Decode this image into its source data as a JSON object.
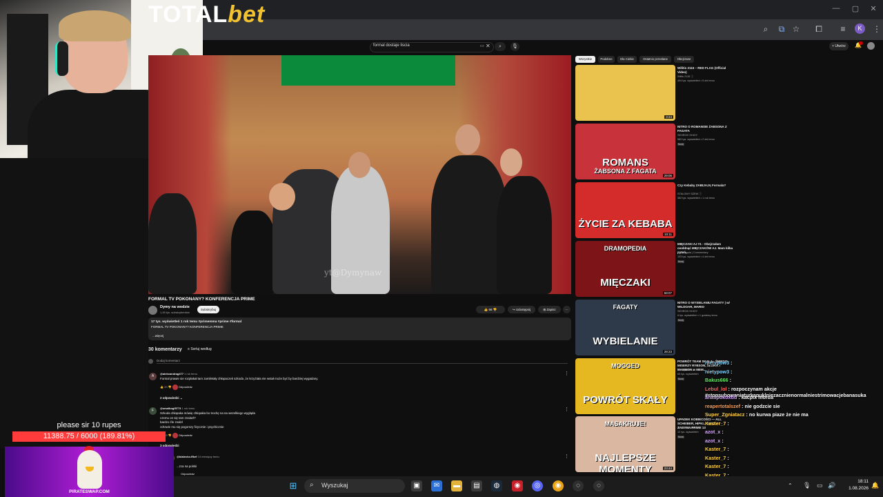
{
  "browser": {
    "window_controls": [
      "—",
      "▢",
      "✕"
    ],
    "profile_letter": "K"
  },
  "youtube": {
    "search_value": "formal dostaje liscia",
    "create_label": "+ Utwórz",
    "video": {
      "banner_brand": "TOTAL",
      "banner_brand_accent": "bet",
      "watermark": "yt@Dymynaw",
      "title": "FORMAL TV POKONANY? KONFERENCJA PRIME",
      "channel_name": "Dymy na wodzie",
      "channel_subs": "1,45 tys. subskrybentów",
      "subscribe_label": "Subskrybuj",
      "likes": "66",
      "share_label": "Udostępnij",
      "save_label": "Zapisz",
      "desc_meta": "17 tys. wyświetleń  1 rok temu  #primemma #prime #formal",
      "desc_line": "FORMAL TV  POKONANY? KONFERENCJA PRIME",
      "desc_more": "...więcej"
    },
    "comments": {
      "count_label": "30 komentarzy",
      "sort_label": "Sortuj według",
      "add_placeholder": "Dodaj komentarz",
      "items": [
        {
          "avatar": "A",
          "author": "@alekxandrag477",
          "time": "1 rok temu",
          "text": "Formal prawie sie rozpłakał tam zamiletały chłopaczek szkoda ,że krzyżtała nie wstał może być by bardziej wygadany.",
          "likes": "20",
          "reply": "Odpowiedz",
          "replies": "2 odpowiedzi"
        },
        {
          "avatar": "F",
          "author": "@smalbogl5773",
          "time": "1 rok temu",
          "text": "Szkoda chłopaka mówię chłopaka bo trochę na na  wszelkiego wygląda\nczemu on się tam znalazł?\nbardzo źle znalzł\nzdrowie mu się pogorszy fizycznie i psychicznie",
          "likes": "19",
          "reply": "Odpowiedz",
          "replies": "3 odpowiedzi"
        },
        {
          "avatar": "K",
          "author": "@bialecko.ffkef",
          "time": "10 miesięcy temu",
          "text": "...zca na polski",
          "likes": "",
          "reply": "Odpowiedz",
          "replies": ""
        }
      ]
    },
    "chips": [
      "Wszystkie",
      "Podobne",
      "Dla Ciebie",
      "Ostatnio przesłane",
      "Obejrzane"
    ],
    "recommendations": [
      {
        "title": "Wiłitis 2115 – RED FLAG (Official Video)",
        "channel": "Witils 2115 ⓘ",
        "meta": "494 tys. wyświetleń • 5 dni temu",
        "badge": "",
        "duration": "3:24",
        "thumb_text": "",
        "thumb_bg": "#e9c34d"
      },
      {
        "title": "NITRO O ROMANSIE ŻABSONA Z FAGATA",
        "channel": "SEHROD SHIOY",
        "meta": "582 tys. wyświetleń • 2 dni temu",
        "badge": "Nowy",
        "duration": "29:06",
        "thumb_text": "ROMANS",
        "thumb_sub": "ŻABSONA Z FAGATA",
        "thumb_bg": "#c8323a"
      },
      {
        "title": "Czy Kebaby ZABIJAJĄ Formala?",
        "channel": "STALOWY SZEW ⓘ",
        "meta": "382 tys. wyświetleń • 1 rok temu",
        "badge": "",
        "duration": "10:11",
        "thumb_text": "ŻYCIE ZA KEBABA",
        "thumb_bg": "#d42b2b"
      },
      {
        "title": "MIĘCZAKI AJ #1 - Obejrzałam osoblnąć MIĘCZAKÓW AJ. Mam kilka pytań...",
        "channel": "chumugoda | Commentary",
        "meta": "193 tys. wyświetleń • 4 dni temu",
        "badge": "Nowy",
        "duration": "58:07",
        "thumb_text": "MIĘCZAKI",
        "thumb_sub": "DRAMOPEDIA",
        "thumb_bg": "#7d1518"
      },
      {
        "title": "NITRO O WYSIELANIU FAGATY | w/ WILDOAR, MARIO",
        "channel": "SEHROD SHIOY",
        "meta": "6 tys. wyświetleń • 1 godzinę temu",
        "badge": "Nowy",
        "duration": "28:23",
        "thumb_text": "WYBIELANIE",
        "thumb_sub": "FAGATY",
        "thumb_bg": "#2e3a4a"
      },
      {
        "title": "POWRÓT TEAM SKAŁA - ŚNIEDZI MISERZY RYBSON, SŁONIK I MAMMON w MEM...",
        "channel": "SubSpacePLO",
        "meta": "60 tys. wyświetleń",
        "badge": "Nowy",
        "duration": "",
        "thumb_text": "POWRÓT SKAŁY",
        "thumb_sub": "MOGGED",
        "thumb_bg": "#e5b821"
      },
      {
        "title": "UPADEK KOBIECOŚCI — ALL SCHEIBER, HIPKI... INEZKA? - ZADYMA PRIME 13",
        "channel": "ALOOKONKURS",
        "meta": "12 tys. wyświetleń",
        "badge": "Nowy",
        "duration": "23:44",
        "thumb_text": "NAJLEPSZE MOMENTY",
        "thumb_sub": "MASAKRUJE!",
        "thumb_bg": "#d9b7a0"
      }
    ]
  },
  "chat": [
    {
      "user": "nietypow3",
      "msg": "",
      "cls": "u1"
    },
    {
      "user": "nietypow3",
      "msg": "",
      "cls": "u1"
    },
    {
      "user": "Bakus666",
      "msg": "",
      "cls": "u2"
    },
    {
      "user": "Lebul_lol",
      "msg": "rozpoczynam akcje #stopsubowaniaturkapuklniezacznienormalniestrimowacjebanasuka",
      "cls": "u6"
    },
    {
      "user": "ahaspokoxdd",
      "msg": "kacpix morda",
      "cls": "u4"
    },
    {
      "user": "reapertotalszef",
      "msg": "nie godzcie sie",
      "cls": "u3"
    },
    {
      "user": "Super_Zgniatacz",
      "msg": "no kurwa piaze że nie ma",
      "cls": "u5"
    },
    {
      "user": "Kaster_7",
      "msg": "",
      "cls": "u5"
    },
    {
      "user": "azot_x",
      "msg": "",
      "cls": "u4"
    },
    {
      "user": "azot_x",
      "msg": "",
      "cls": "u4"
    },
    {
      "user": "Kaster_7",
      "msg": "",
      "cls": "u5"
    },
    {
      "user": "Kaster_7",
      "msg": "",
      "cls": "u5"
    },
    {
      "user": "Kaster_7",
      "msg": "",
      "cls": "u5"
    },
    {
      "user": "Kaster_7",
      "msg": "",
      "cls": "u5"
    }
  ],
  "donation": {
    "message": "please sir 10 rupes",
    "progress_text": "11388.75 / 6000 (189.81%)",
    "progress_fraction": 1.0,
    "sponsor": "PIRATESWAP.COM"
  },
  "taskbar": {
    "search_label": "Wyszukaj",
    "time": "18:11",
    "date": "1.08.2026"
  }
}
